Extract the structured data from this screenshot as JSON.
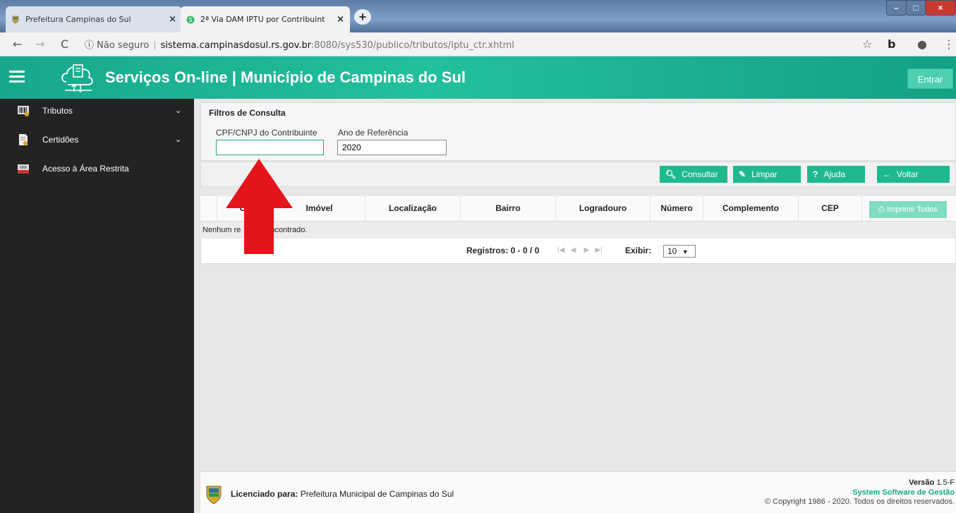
{
  "browser": {
    "tabs": [
      {
        "title": "Prefeitura Campinas do Sul",
        "close": "×",
        "active": false
      },
      {
        "title": "2ª Via DAM IPTU por Contribuint",
        "close": "×",
        "active": true
      }
    ],
    "new_tab": "+",
    "security": "Não seguro",
    "url_host": "sistema.campinasdosul.rs.gov.br",
    "url_path": ":8080/sys530/publico/tributos/iptu_ctr.xhtml",
    "win_controls": [
      "–",
      "□",
      "×"
    ]
  },
  "header": {
    "title": "Serviços On-line | Município de Campinas do Sul",
    "login_label": "Entrar"
  },
  "sidebar": {
    "items": [
      {
        "label": "Tributos",
        "has_submenu": true,
        "icon": "barcode-icon"
      },
      {
        "label": "Certidões",
        "has_submenu": true,
        "icon": "document-icon"
      },
      {
        "label": "Acesso à Área Restrita",
        "has_submenu": false,
        "icon": "lock-icon"
      }
    ]
  },
  "filters": {
    "title": "Filtros de Consulta",
    "cpf_label": "CPF/CNPJ do Contribuinte",
    "cpf_value": "",
    "year_label": "Ano de Referência",
    "year_value": "2020"
  },
  "actions": {
    "consultar": "Consultar",
    "limpar": "Limpar",
    "ajuda": "Ajuda",
    "voltar": "Voltar"
  },
  "table": {
    "columns": [
      "Co",
      "Imóvel",
      "Localização",
      "Bairro",
      "Logradouro",
      "Número",
      "Complemento",
      "CEP"
    ],
    "print_all": "Imprimir Todos",
    "empty_message": "Nenhum re",
    "empty_message_tail": "ncontrado."
  },
  "pager": {
    "records": "Registros: 0 - 0 / 0",
    "show_label": "Exibir:",
    "page_size": "10"
  },
  "footer": {
    "licensed_label": "Licenciado para:",
    "licensed_to": "Prefeitura Municipal de Campinas do Sul",
    "version_label": "Versão",
    "version_value": "1.5-F",
    "company": "System Software de Gestão",
    "copyright": "© Copyright 1986 - 2020. Todos os direitos reservados."
  },
  "colors": {
    "header_green": "#1cb390",
    "button_green": "#1fb98f",
    "sidebar_dark": "#232323",
    "arrow_red": "#e3141c"
  }
}
